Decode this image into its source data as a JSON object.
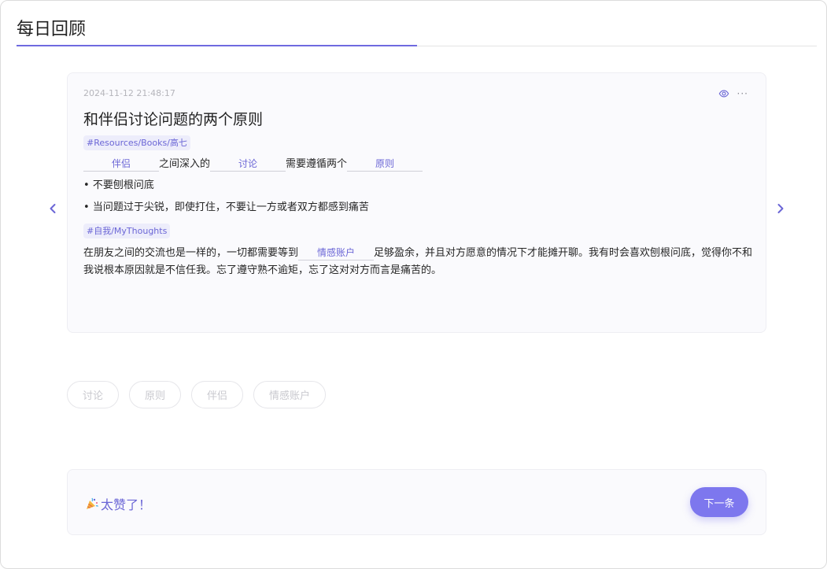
{
  "header": {
    "title": "每日回顾"
  },
  "note": {
    "timestamp": "2024-11-12 21:48:17",
    "title": "和伴侣讨论问题的两个原则",
    "tag1": "#Resources/Books/高七",
    "line1": {
      "blank1": "伴侣",
      "text1": "之间深入的",
      "blank2": "讨论",
      "text2": "需要遵循两个",
      "blank3": "原则"
    },
    "bullets": [
      "不要刨根问底",
      "当问题过于尖锐，即使打住，不要让一方或者双方都感到痛苦"
    ],
    "tag2": "#自我/MyThoughts",
    "para": {
      "before": "在朋友之间的交流也是一样的，一切都需要等到",
      "blank": "情感账户",
      "after": "足够盈余，并且对方愿意的情况下才能摊开聊。我有时会喜欢刨根问底，觉得你不和我说根本原因就是不信任我。忘了遵守熟不逾矩，忘了这对对方而言是痛苦的。"
    }
  },
  "chips": [
    "讨论",
    "原则",
    "伴侣",
    "情感账户"
  ],
  "footer": {
    "congrats": "太赞了！",
    "next_label": "下一条"
  },
  "colors": {
    "accent": "#7d77ee",
    "tag_bg": "#ededfb",
    "tag_text": "#6b66d6"
  },
  "icons": {
    "eye": "eye-icon",
    "more": "more-icon",
    "prev": "chevron-left-icon",
    "next": "chevron-right-icon",
    "party": "party-popper-icon"
  }
}
